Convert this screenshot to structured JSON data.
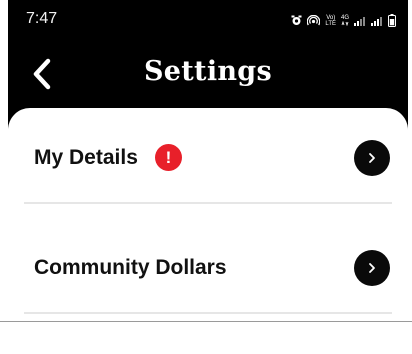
{
  "status_bar": {
    "time": "7:47",
    "network_top": "Vo)",
    "network_bottom": "LTE",
    "signal_label": "4G"
  },
  "header": {
    "title": "Settings",
    "back_icon": "chevron-left-icon"
  },
  "settings": {
    "items": [
      {
        "label": "My Details",
        "badge": "!",
        "badge_color": "#e8202a"
      },
      {
        "label": "Community Dollars"
      }
    ]
  },
  "colors": {
    "background": "#000000",
    "card": "#ffffff",
    "accent_alert": "#e8202a"
  }
}
